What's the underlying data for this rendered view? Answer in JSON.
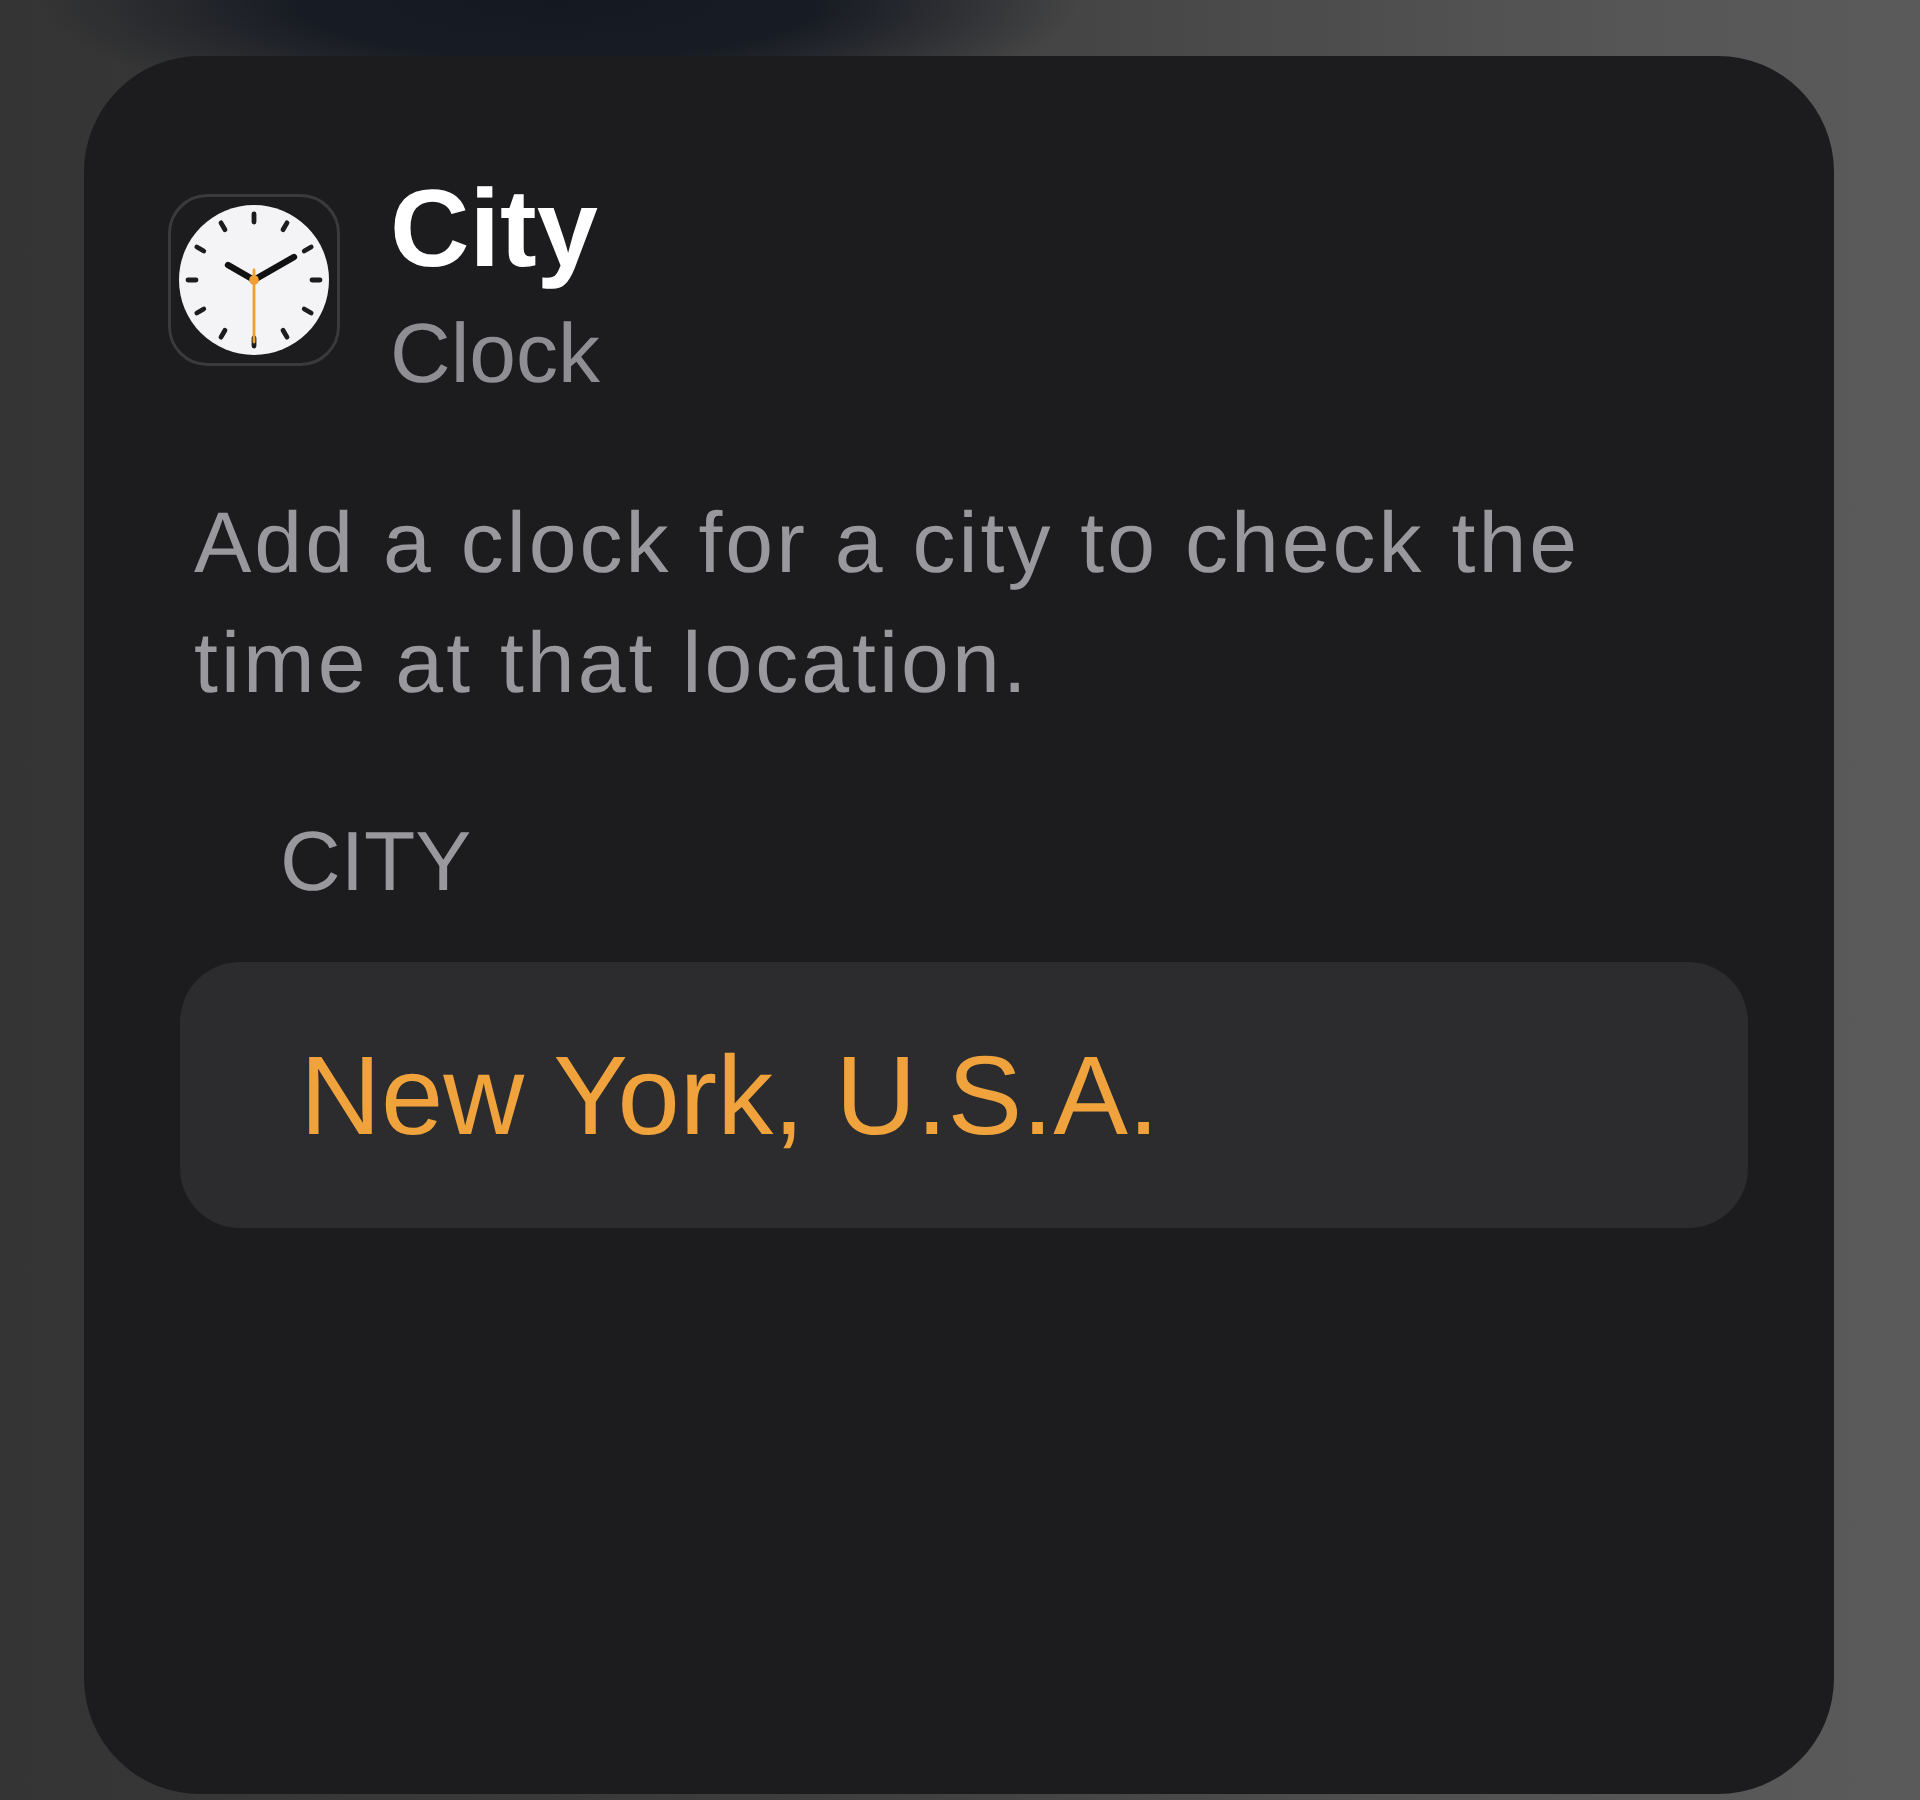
{
  "widget": {
    "title": "City",
    "app_name": "Clock",
    "description": "Add a clock for a city to check the time at that location."
  },
  "parameter": {
    "label": "CITY",
    "value": "New York, U.S.A."
  }
}
